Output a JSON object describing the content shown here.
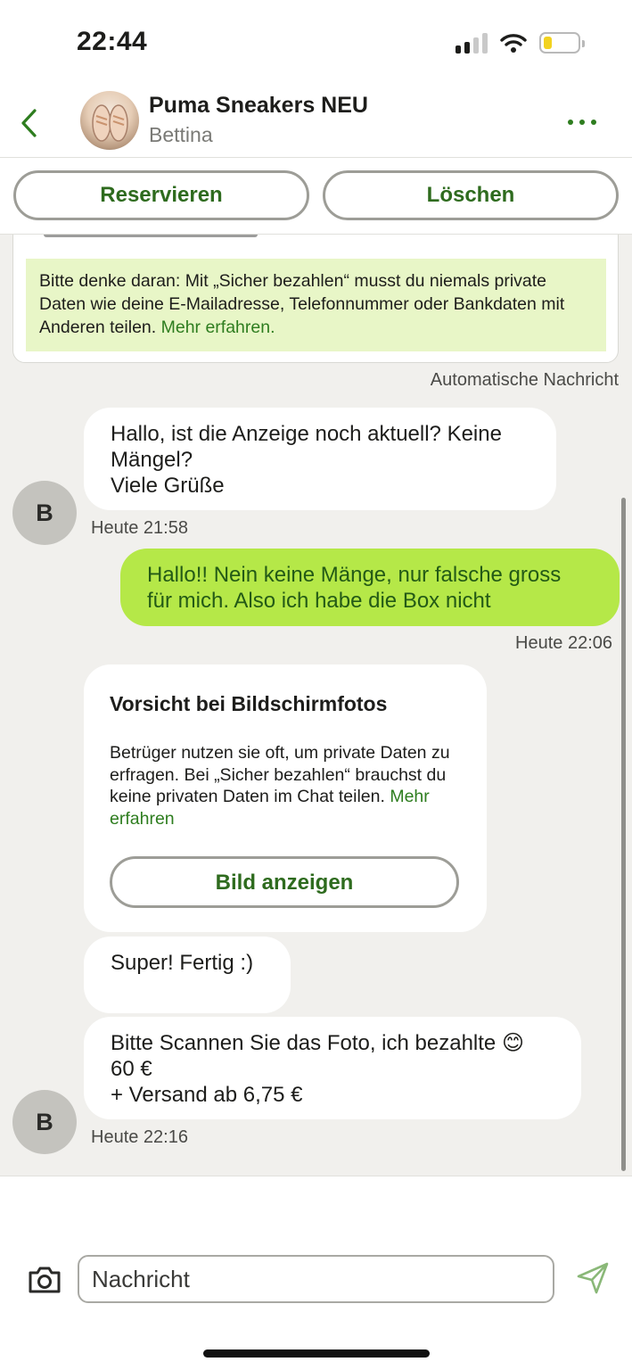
{
  "status_bar": {
    "time": "22:44",
    "icons": [
      "signal-icon",
      "wifi-icon",
      "battery-icon"
    ],
    "battery_color": "#f2d21f"
  },
  "header": {
    "back_icon": "chevron-left-icon",
    "title": "Puma Sneakers NEU",
    "subtitle": "Bettina",
    "more_icon": "more-dots-icon"
  },
  "actions": {
    "reserve_label": "Reservieren",
    "delete_label": "Löschen"
  },
  "auto_message": {
    "notice_text": "Bitte denke daran: Mit „Sicher bezahlen“ musst du niemals private Daten wie deine E-Mailadresse, Telefonnummer oder Bankdaten mit Anderen teilen.",
    "link_text": "Mehr erfahren.",
    "label": "Automatische Nachricht"
  },
  "messages": [
    {
      "direction": "in",
      "lines": [
        "Hallo, ist die Anzeige noch aktuell? Keine",
        "Mängel?",
        "Viele Grüße"
      ],
      "time": "Heute 21:58",
      "avatar_letter": "B"
    },
    {
      "direction": "out",
      "lines": [
        "Hallo!! Nein keine Mänge, nur falsche gross",
        "für mich. Also ich habe die Box nicht"
      ],
      "time": "Heute 22:06"
    },
    {
      "direction": "in",
      "type": "warning",
      "title": "Vorsicht bei Bildschirmfotos",
      "body": "Betrüger nutzen sie oft, um private Daten zu erfragen. Bei „Sicher bezahlen“ brauchst du keine privaten Daten im Chat teilen.",
      "link_text": "Mehr erfahren",
      "button_label": "Bild anzeigen"
    },
    {
      "direction": "in",
      "lines": [
        "Super! Fertig :)"
      ]
    },
    {
      "direction": "in",
      "lines": [
        "Bitte Scannen Sie das Foto, ich bezahlte",
        "60 €",
        "+ Versand ab 6,75 €"
      ],
      "emoji": "😊",
      "time": "Heute 22:16",
      "avatar_letter": "B"
    }
  ],
  "composer": {
    "camera_icon": "camera-icon",
    "placeholder": "Nachricht",
    "send_icon": "send-icon"
  },
  "colors": {
    "accent_green": "#2e7d1f",
    "outgoing_bubble": "#b5e848",
    "notice_background": "#e8f6c7",
    "chat_background": "#f1f0ed"
  }
}
